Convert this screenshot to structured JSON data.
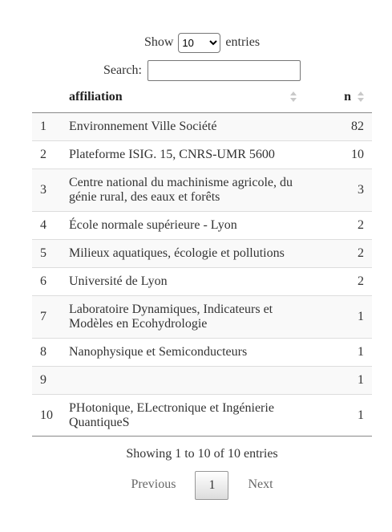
{
  "length_control": {
    "prefix": "Show",
    "selected": "10",
    "suffix": "entries"
  },
  "search": {
    "label": "Search:",
    "value": ""
  },
  "table": {
    "columns": [
      "",
      "affiliation",
      "n"
    ],
    "rows": [
      {
        "idx": "1",
        "affiliation": "Environnement Ville Société",
        "n": "82"
      },
      {
        "idx": "2",
        "affiliation": "Plateforme ISIG. 15, CNRS-UMR 5600",
        "n": "10"
      },
      {
        "idx": "3",
        "affiliation": "Centre national du machinisme agricole, du génie rural, des eaux et forêts",
        "n": "3"
      },
      {
        "idx": "4",
        "affiliation": "École normale supérieure - Lyon",
        "n": "2"
      },
      {
        "idx": "5",
        "affiliation": "Milieux aquatiques, écologie et pollutions",
        "n": "2"
      },
      {
        "idx": "6",
        "affiliation": "Université de Lyon",
        "n": "2"
      },
      {
        "idx": "7",
        "affiliation": "Laboratoire Dynamiques, Indicateurs et Modèles en Ecohydrologie",
        "n": "1"
      },
      {
        "idx": "8",
        "affiliation": "Nanophysique et Semiconducteurs",
        "n": "1"
      },
      {
        "idx": "9",
        "affiliation": "",
        "n": "1"
      },
      {
        "idx": "10",
        "affiliation": "PHotonique, ELectronique et Ingénierie QuantiqueS",
        "n": "1"
      }
    ]
  },
  "info": "Showing 1 to 10 of 10 entries",
  "pagination": {
    "previous": "Previous",
    "current": "1",
    "next": "Next"
  }
}
